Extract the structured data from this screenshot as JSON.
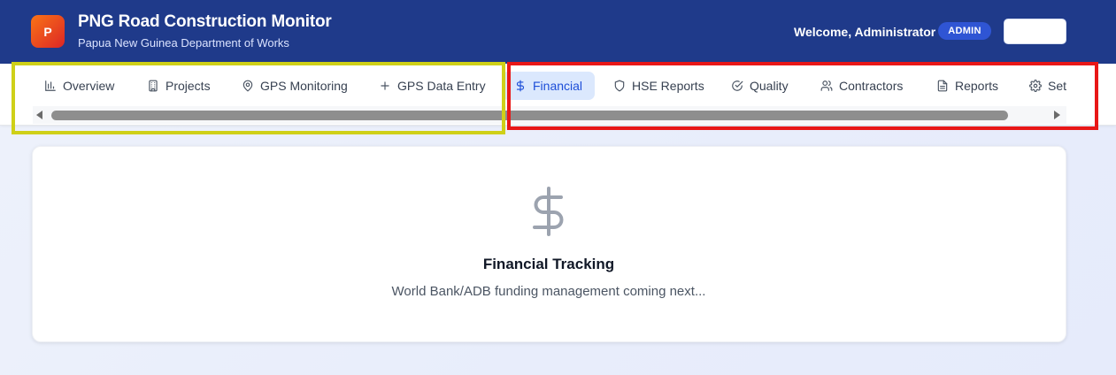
{
  "header": {
    "logo_letter": "P",
    "title": "PNG Road Construction Monitor",
    "subtitle": "Papua New Guinea Department of Works",
    "welcome": "Welcome, Administrator",
    "role_badge": "ADMIN",
    "action_button_label": ""
  },
  "nav": {
    "tabs": [
      {
        "label": "Overview",
        "icon": "bar-chart-icon",
        "active": false
      },
      {
        "label": "Projects",
        "icon": "building-icon",
        "active": false
      },
      {
        "label": "GPS Monitoring",
        "icon": "map-pin-icon",
        "active": false
      },
      {
        "label": "GPS Data Entry",
        "icon": "plus-icon",
        "active": false
      },
      {
        "label": "Financial",
        "icon": "dollar-icon",
        "active": true
      },
      {
        "label": "HSE Reports",
        "icon": "shield-icon",
        "active": false
      },
      {
        "label": "Quality",
        "icon": "check-circle-icon",
        "active": false
      },
      {
        "label": "Contractors",
        "icon": "users-icon",
        "active": false
      },
      {
        "label": "Reports",
        "icon": "file-text-icon",
        "active": false
      },
      {
        "label": "Set",
        "icon": "gear-icon",
        "active": false
      }
    ]
  },
  "content": {
    "icon": "dollar-icon",
    "title": "Financial Tracking",
    "description": "World Bank/ADB funding management coming next..."
  },
  "colors": {
    "header_bg": "#1f3a8a",
    "active_tab_bg": "#dbe8fd",
    "active_tab_text": "#1d4ed8",
    "highlight_yellow": "#cfd018",
    "highlight_red": "#e81717"
  }
}
